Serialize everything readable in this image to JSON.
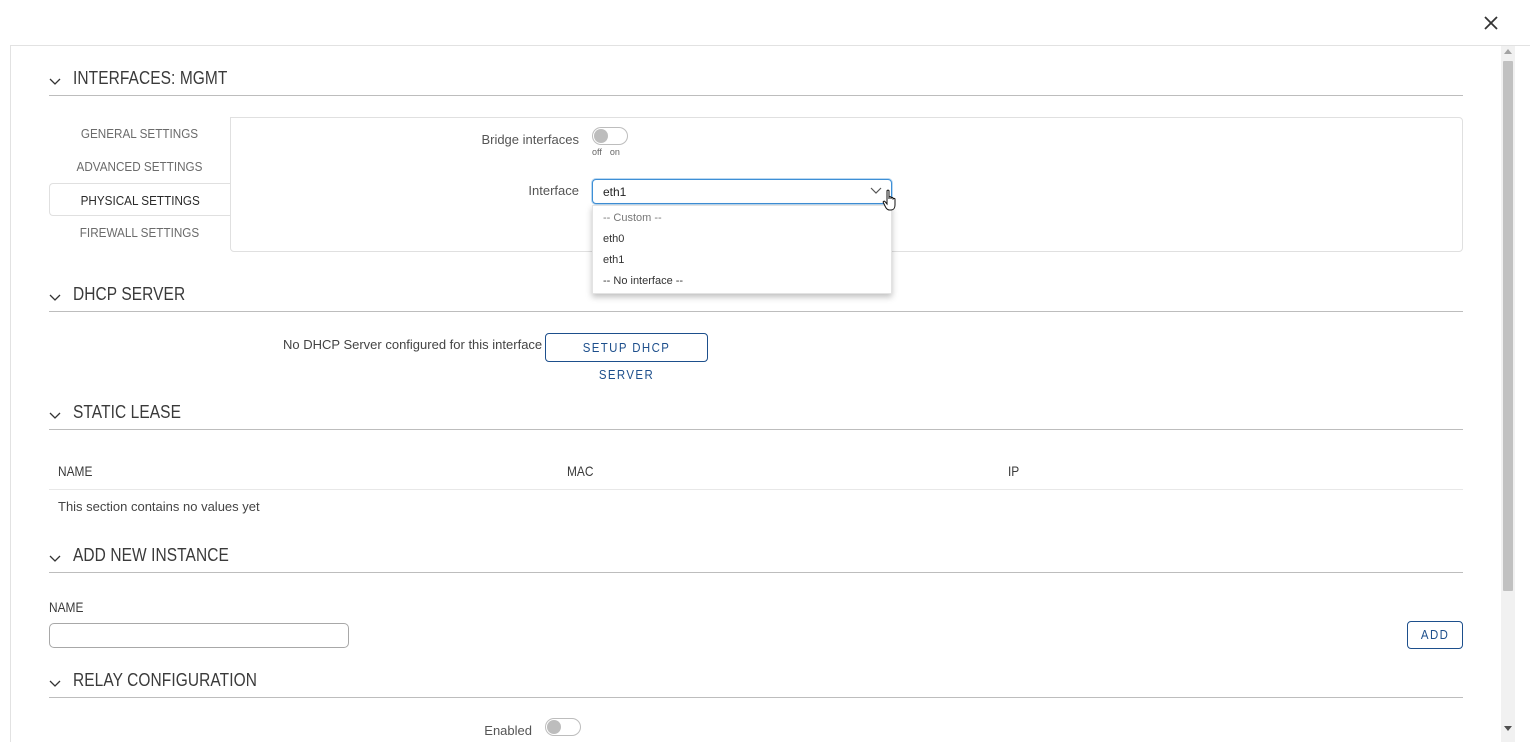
{
  "sections": {
    "interfaces": {
      "title": "INTERFACES: MGMT"
    },
    "dhcp": {
      "title": "DHCP SERVER"
    },
    "static_lease": {
      "title": "STATIC LEASE"
    },
    "add_instance": {
      "title": "ADD NEW INSTANCE"
    },
    "relay": {
      "title": "RELAY CONFIGURATION"
    }
  },
  "tabs": [
    {
      "label": "GENERAL SETTINGS",
      "active": false
    },
    {
      "label": "ADVANCED SETTINGS",
      "active": false
    },
    {
      "label": "PHYSICAL SETTINGS",
      "active": true
    },
    {
      "label": "FIREWALL SETTINGS",
      "active": false
    }
  ],
  "physical": {
    "bridge_label": "Bridge interfaces",
    "bridge_value": "off",
    "toggle_off": "off",
    "toggle_on": "on",
    "interface_label": "Interface",
    "interface_value": "eth1",
    "options": [
      "-- Custom --",
      "eth0",
      "eth1",
      "-- No interface --"
    ]
  },
  "dhcp": {
    "note": "No DHCP Server configured for this interface",
    "setup_button": "SETUP DHCP SERVER"
  },
  "static_lease": {
    "columns": [
      "NAME",
      "MAC",
      "IP"
    ],
    "empty_text": "This section contains no values yet"
  },
  "add_instance": {
    "name_label": "NAME",
    "name_value": "",
    "add_button": "ADD"
  },
  "relay": {
    "enabled_label": "Enabled",
    "enabled_value": "off"
  },
  "icons": {
    "close": "close-icon",
    "section_toggle": "chevron-down-icon",
    "select_arrow": "chevron-down-icon",
    "cursor": "hand-pointer-icon"
  },
  "colors": {
    "accent": "#1d4f8c",
    "focus": "#3d8fd6",
    "text": "#404040"
  }
}
